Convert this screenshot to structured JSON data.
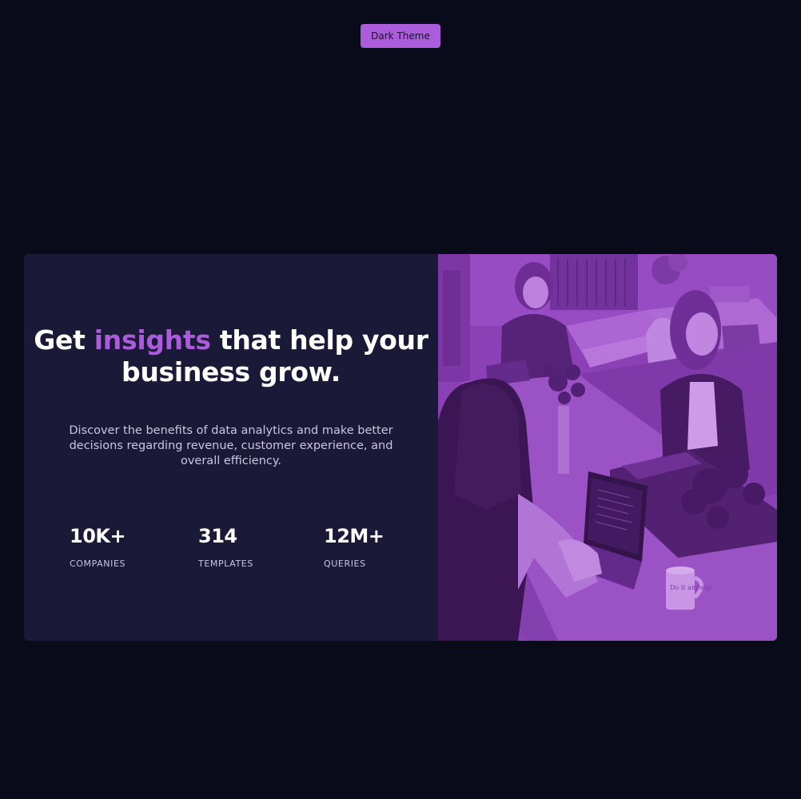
{
  "theme_toggle": {
    "label": "Dark Theme"
  },
  "hero": {
    "headline_before": "Get ",
    "headline_accent": "insights",
    "headline_after": " that help your business grow.",
    "description": "Discover the benefits of data analytics and make better decisions regarding revenue, customer experience, and overall efficiency.",
    "stats": [
      {
        "value": "10K+",
        "label": "COMPANIES"
      },
      {
        "value": "314",
        "label": "TEMPLATES"
      },
      {
        "value": "12M+",
        "label": "QUERIES"
      }
    ]
  },
  "image": {
    "mug_text": "Do it anyway"
  },
  "colors": {
    "background": "#0a0b1a",
    "card": "#1b1938",
    "accent": "#aa5cdb",
    "text_primary": "#ffffff",
    "text_secondary": "#c9c6e0"
  }
}
